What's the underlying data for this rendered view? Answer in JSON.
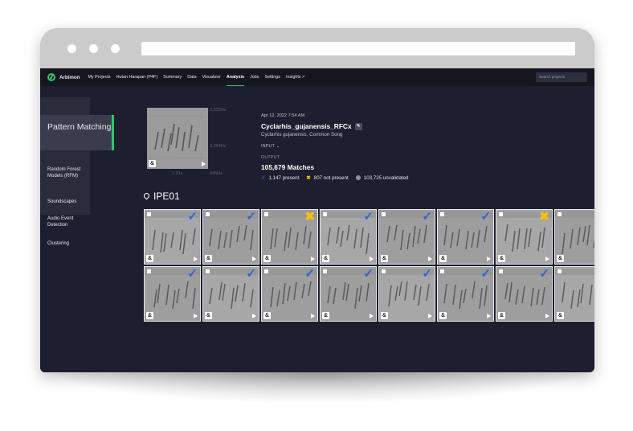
{
  "nav": {
    "brand": "Arbimon",
    "items": [
      "My Projects",
      "Hutan Harapan (P4F)",
      "Summary",
      "Data",
      "Visualizer",
      "Analysis",
      "Jobs",
      "Settings",
      "Insights"
    ],
    "active": "Analysis",
    "search_placeholder": "Search projects"
  },
  "sidebar": {
    "active": "Pattern Matching",
    "items": [
      "Random Forest Models (RFM)",
      "Soundscapes",
      "Audio Event Detection",
      "Clustering"
    ]
  },
  "job": {
    "freq_high": "3,935Hz",
    "freq_mid": "3,094Hz",
    "duration": "1.31s",
    "freq_low": "845Hz",
    "date": "Apr 12, 2022 7:54 AM",
    "title": "Cyclarhis_gujanensis_RFCx",
    "subtitle": "Cyclarhis gujanensis, Common Song",
    "input_label": "INPUT",
    "output_label": "OUTPUT",
    "matches": "105,679 Matches",
    "present": "1,147 present",
    "not_present": "807 not present",
    "unvalidated": "103,725 unvalidated"
  },
  "site": {
    "name": "IPE01"
  },
  "tiles": [
    {
      "status": "present"
    },
    {
      "status": "present"
    },
    {
      "status": "absent"
    },
    {
      "status": "present"
    },
    {
      "status": "present"
    },
    {
      "status": "present"
    },
    {
      "status": "absent"
    },
    {
      "status": "present"
    },
    {
      "status": "present"
    },
    {
      "status": "present"
    },
    {
      "status": "present"
    },
    {
      "status": "present"
    },
    {
      "status": "present"
    },
    {
      "status": "present"
    },
    {
      "status": "present"
    },
    {
      "status": "present"
    }
  ],
  "colors": {
    "accent": "#31c46b",
    "present": "#2f64d6",
    "absent": "#f4c10d",
    "background": "#1d1f30"
  },
  "icons": {
    "check": "check-icon",
    "cross": "cross-icon",
    "play": "play-icon",
    "pin": "pin-icon",
    "edit": "pencil-icon"
  }
}
